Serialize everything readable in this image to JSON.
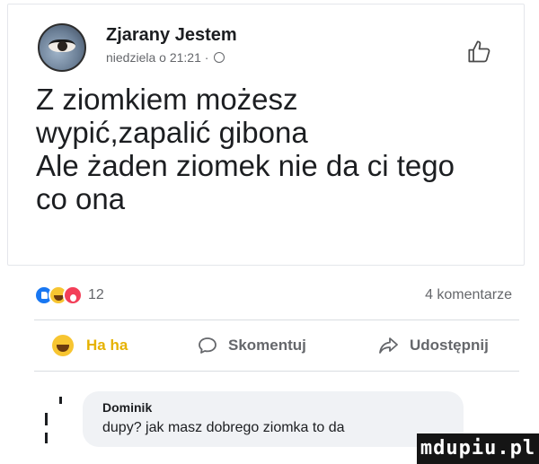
{
  "post": {
    "author": "Zjarany Jestem",
    "meta": "niedziela o 21:21 ·",
    "text": "Z ziomkiem możesz\nwypić,zapalić gibona\nAle żaden ziomek nie da ci tego\nco ona"
  },
  "reactions": {
    "count": "12",
    "types": [
      "like-icon",
      "haha-icon",
      "wow-icon"
    ]
  },
  "comments_count": "4 komentarze",
  "actions": {
    "haha": "Ha ha",
    "comment": "Skomentuj",
    "share": "Udostępnij"
  },
  "comment": {
    "author": "Dominik",
    "text": "dupy? jak masz dobrego ziomka to da"
  },
  "watermark": "mdupiu.pl",
  "colors": {
    "brand_blue": "#1877f2",
    "haha_yellow": "#f7c531",
    "text": "#1c1e21",
    "muted": "#65676b",
    "bubble": "#f0f2f5"
  }
}
